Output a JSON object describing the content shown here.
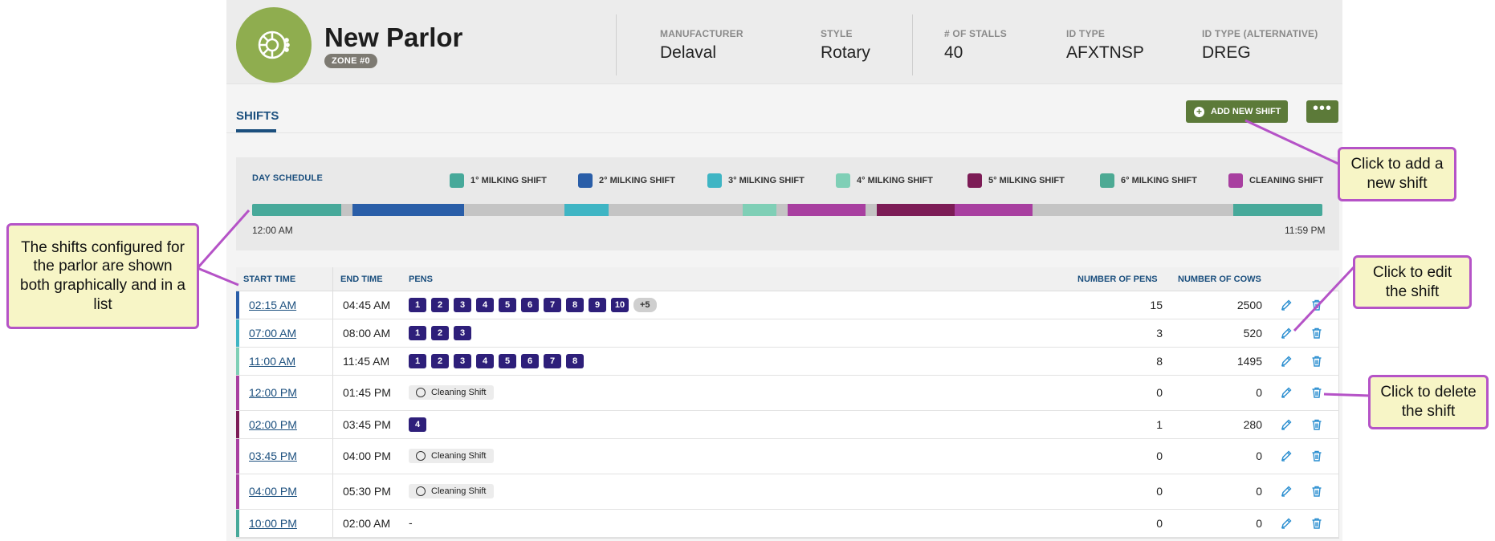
{
  "colors": {
    "accent_blue": "#1b4f7e",
    "button_green": "#5c7a39",
    "logo_green": "#8fad4f",
    "pen_badge": "#2e1f7a",
    "callout_border": "#b553c7",
    "callout_fill": "#f7f5c6"
  },
  "header": {
    "title": "New Parlor",
    "zone": "ZONE #0",
    "logo_icon": "rotary-parlor-icon",
    "meta": [
      {
        "label": "MANUFACTURER",
        "value": "Delaval"
      },
      {
        "label": "STYLE",
        "value": "Rotary"
      },
      {
        "label": "# OF STALLS",
        "value": "40"
      },
      {
        "label": "ID TYPE",
        "value": "AFXTNSP"
      },
      {
        "label": "ID TYPE (ALTERNATIVE)",
        "value": "DREG"
      }
    ]
  },
  "tabs": {
    "shifts": "SHIFTS"
  },
  "actions": {
    "add_shift": "ADD NEW SHIFT",
    "more": "•••"
  },
  "schedule": {
    "title": "DAY SCHEDULE",
    "start_label": "12:00 AM",
    "end_label": "11:59 PM",
    "legend": [
      {
        "label": "1° MILKING SHIFT",
        "color": "#47a99a"
      },
      {
        "label": "2° MILKING SHIFT",
        "color": "#2a5ea8"
      },
      {
        "label": "3° MILKING SHIFT",
        "color": "#3fb5c4"
      },
      {
        "label": "4° MILKING SHIFT",
        "color": "#7fcfb6"
      },
      {
        "label": "5° MILKING SHIFT",
        "color": "#7c1c56"
      },
      {
        "label": "6° MILKING SHIFT",
        "color": "#4daa94"
      },
      {
        "label": "CLEANING SHIFT",
        "color": "#a83fa0"
      }
    ],
    "segments": [
      {
        "start_h": 0.0,
        "end_h": 2.0,
        "color": "#47a99a"
      },
      {
        "start_h": 2.25,
        "end_h": 4.75,
        "color": "#2a5ea8"
      },
      {
        "start_h": 7.0,
        "end_h": 8.0,
        "color": "#3fb5c4"
      },
      {
        "start_h": 11.0,
        "end_h": 11.75,
        "color": "#7fcfb6"
      },
      {
        "start_h": 12.0,
        "end_h": 13.75,
        "color": "#a83fa0"
      },
      {
        "start_h": 14.0,
        "end_h": 15.75,
        "color": "#7c1c56"
      },
      {
        "start_h": 15.75,
        "end_h": 17.5,
        "color": "#a83fa0"
      },
      {
        "start_h": 22.0,
        "end_h": 24.0,
        "color": "#47a99a"
      }
    ]
  },
  "table": {
    "headers": {
      "start": "START TIME",
      "end": "END TIME",
      "pens": "PENS",
      "num_pens": "NUMBER OF PENS",
      "num_cows": "NUMBER OF COWS"
    },
    "rows": [
      {
        "start": "02:15 AM",
        "end": "04:45 AM",
        "pens": [
          "1",
          "2",
          "3",
          "4",
          "5",
          "6",
          "7",
          "8",
          "9",
          "10"
        ],
        "more": "+5",
        "num_pens": "15",
        "num_cows": "2500",
        "edge": "#2a5ea8"
      },
      {
        "start": "07:00 AM",
        "end": "08:00 AM",
        "pens": [
          "1",
          "2",
          "3"
        ],
        "num_pens": "3",
        "num_cows": "520",
        "edge": "#3fb5c4"
      },
      {
        "start": "11:00 AM",
        "end": "11:45 AM",
        "pens": [
          "1",
          "2",
          "3",
          "4",
          "5",
          "6",
          "7",
          "8"
        ],
        "num_pens": "8",
        "num_cows": "1495",
        "edge": "#7fcfb6"
      },
      {
        "start": "12:00 PM",
        "end": "01:45 PM",
        "cleaning": "Cleaning Shift",
        "num_pens": "0",
        "num_cows": "0",
        "edge": "#a83fa0"
      },
      {
        "start": "02:00 PM",
        "end": "03:45 PM",
        "pens": [
          "4"
        ],
        "num_pens": "1",
        "num_cows": "280",
        "edge": "#7c1c56"
      },
      {
        "start": "03:45 PM",
        "end": "04:00 PM",
        "cleaning": "Cleaning Shift",
        "num_pens": "0",
        "num_cows": "0",
        "edge": "#a83fa0"
      },
      {
        "start": "04:00 PM",
        "end": "05:30 PM",
        "cleaning": "Cleaning Shift",
        "num_pens": "0",
        "num_cows": "0",
        "edge": "#a83fa0"
      },
      {
        "start": "10:00 PM",
        "end": "02:00 AM",
        "placeholder": "-",
        "num_pens": "0",
        "num_cows": "0",
        "edge": "#47a99a"
      }
    ]
  },
  "callouts": {
    "shifts_list": "The shifts configured for the parlor are shown both graphically and in a list",
    "add": "Click to add a new shift",
    "edit": "Click to edit the shift",
    "delete": "Click to delete the shift"
  }
}
